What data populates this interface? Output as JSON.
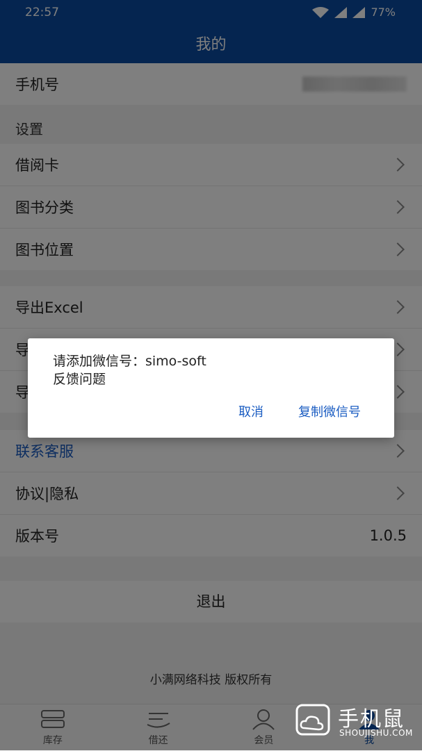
{
  "status": {
    "time": "22:57",
    "battery": "77%"
  },
  "header": {
    "title": "我的"
  },
  "phone": {
    "label": "手机号"
  },
  "settings": {
    "title": "设置",
    "items": [
      {
        "label": "借阅卡"
      },
      {
        "label": "图书分类"
      },
      {
        "label": "图书位置"
      }
    ]
  },
  "data_items": [
    {
      "label": "导出Excel"
    },
    {
      "label": "导"
    },
    {
      "label": "导"
    }
  ],
  "support": {
    "contact": "联系客服",
    "privacy": "协议|隐私",
    "version_label": "版本号",
    "version_value": "1.0.5"
  },
  "logout": {
    "label": "退出"
  },
  "copyright": "小满网络科技 版权所有",
  "tabs": [
    {
      "label": "库存"
    },
    {
      "label": "借还"
    },
    {
      "label": "会员"
    },
    {
      "label": "我"
    }
  ],
  "dialog": {
    "line1": "请添加微信号：simo-soft",
    "line2": "反馈问题",
    "cancel": "取消",
    "copy": "复制微信号"
  },
  "watermark": {
    "big": "手机鼠",
    "small": "SHOUJISHU.COM"
  }
}
